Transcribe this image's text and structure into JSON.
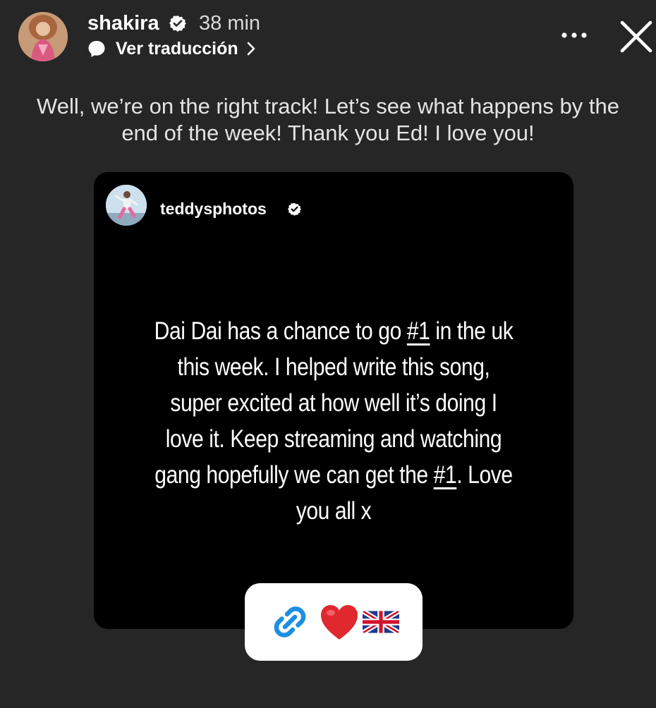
{
  "header": {
    "username": "shakira",
    "time_ago": "38 min",
    "translate_label": "Ver traducción"
  },
  "caption": "Well, we’re on the right track! Let’s see what happens by the end of the week! Thank  you Ed! I love you!",
  "shared_post": {
    "username": "teddysphotos",
    "text_parts": [
      "Dai Dai has a chance to go ",
      "#1",
      " in the uk this week. I helped write this song, super excited at how well it’s doing I love it. Keep streaming and watching gang hopefully we can get the ",
      "#1",
      ". Love you all x"
    ]
  },
  "sticker": {
    "icons": [
      "link-icon",
      "heart-icon",
      "uk-flag-icon"
    ]
  },
  "colors": {
    "background": "#262626",
    "card": "#000000",
    "link_blue": "#1e8fe1",
    "heart_red": "#e0282f"
  }
}
